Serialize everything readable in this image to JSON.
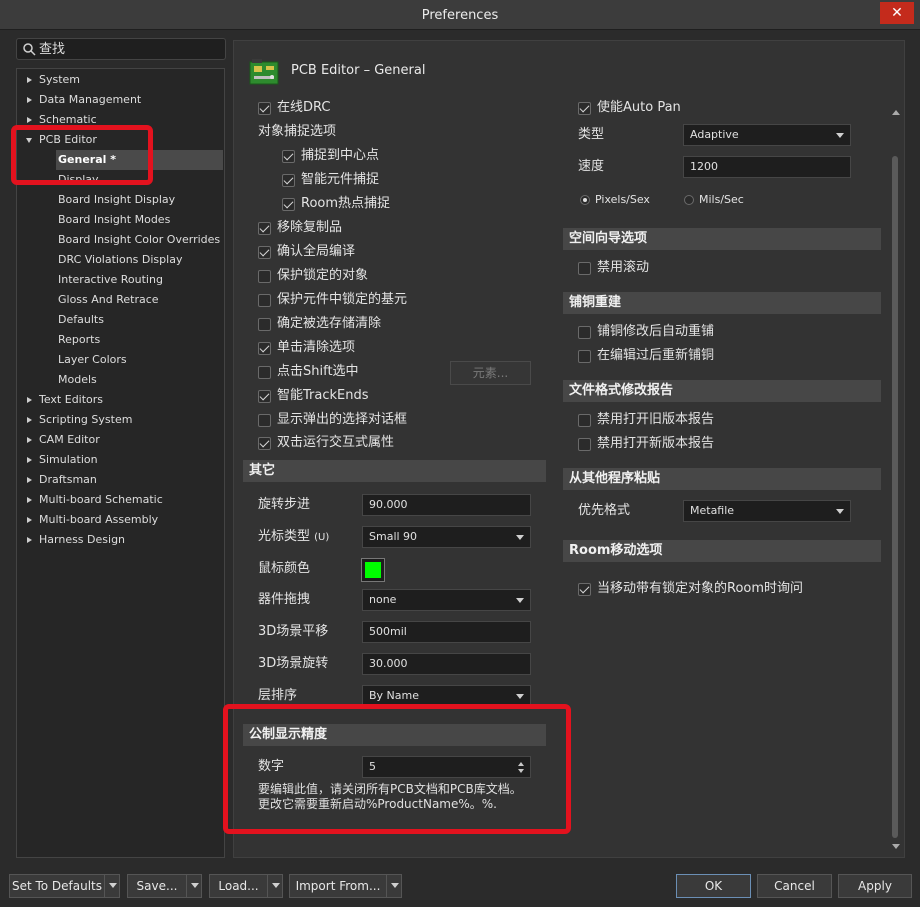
{
  "window": {
    "title": "Preferences",
    "close_glyph": "✕"
  },
  "search": {
    "placeholder": "查找"
  },
  "tree": {
    "items": [
      {
        "label": "System"
      },
      {
        "label": "Data Management"
      },
      {
        "label": "Schematic"
      },
      {
        "label": "PCB Editor"
      },
      {
        "label": "General *"
      },
      {
        "label": "Display"
      },
      {
        "label": "Board Insight Display"
      },
      {
        "label": "Board Insight Modes"
      },
      {
        "label": "Board Insight Color Overrides"
      },
      {
        "label": "DRC Violations Display"
      },
      {
        "label": "Interactive Routing"
      },
      {
        "label": "Gloss And Retrace"
      },
      {
        "label": "Defaults"
      },
      {
        "label": "Reports"
      },
      {
        "label": "Layer Colors"
      },
      {
        "label": "Models"
      },
      {
        "label": "Text Editors"
      },
      {
        "label": "Scripting System"
      },
      {
        "label": "CAM Editor"
      },
      {
        "label": "Simulation"
      },
      {
        "label": "Draftsman"
      },
      {
        "label": "Multi-board Schematic"
      },
      {
        "label": "Multi-board Assembly"
      },
      {
        "label": "Harness Design"
      }
    ]
  },
  "page": {
    "title": "PCB Editor – General"
  },
  "left_col": {
    "online_drc": "在线DRC",
    "snap_group": "对象捕捉选项",
    "snap_center": "捕捉到中心点",
    "smart_snap": "智能元件捕捉",
    "room_snap": "Room热点捕捉",
    "remove_dup": "移除复制品",
    "confirm_global": "确认全局编译",
    "protect_locked": "保护锁定的对象",
    "protect_primitives": "保护元件中锁定的基元",
    "confirm_clear": "确定被选存储清除",
    "click_clear": "单击清除选项",
    "shift_click": "点击Shift选中",
    "primitives_btn": "元素...",
    "smart_trackends": "智能TrackEnds",
    "show_popup": "显示弹出的选择对话框",
    "dblclick_inspect": "双击运行交互式属性"
  },
  "other": {
    "header": "其它",
    "rotation_step": {
      "label": "旋转步进",
      "value": "90.000"
    },
    "cursor_type": {
      "label": "光标类型",
      "hotkey": "(U)",
      "value": "Small 90"
    },
    "cursor_color": {
      "label": "鼠标颜色",
      "color": "#00ff00"
    },
    "comp_drag": {
      "label": "器件拖拽",
      "value": "none"
    },
    "pan_3d": {
      "label": "3D场景平移",
      "value": "500mil"
    },
    "rotate_3d": {
      "label": "3D场景旋转",
      "value": "30.000"
    },
    "layer_order": {
      "label": "层排序",
      "value": "By Name"
    }
  },
  "metric": {
    "header": "公制显示精度",
    "digits": {
      "label": "数字",
      "value": "5"
    },
    "note_line1": "要编辑此值，请关闭所有PCB文档和PCB库文档。",
    "note_line2": "更改它需要重新启动%ProductName%。%."
  },
  "right_col": {
    "autopan": "使能Auto Pan",
    "type": {
      "label": "类型",
      "value": "Adaptive"
    },
    "speed": {
      "label": "速度",
      "value": "1200"
    },
    "pixels": "Pixels/Sex",
    "mils": "Mils/Sec",
    "space_nav_header": "空间向导选项",
    "disable_scroll": "禁用滚动",
    "pour_header": "铺铜重建",
    "repour_modify": "铺铜修改后自动重铺",
    "repour_edit": "在编辑过后重新铺铜",
    "file_mod_header": "文件格式修改报告",
    "disable_old": "禁用打开旧版本报告",
    "disable_new": "禁用打开新版本报告",
    "paste_header": "从其他程序粘贴",
    "pref_format": {
      "label": "优先格式",
      "value": "Metafile"
    },
    "room_move_header": "Room移动选项",
    "room_move_ask": "当移动带有锁定对象的Room时询问"
  },
  "buttons": {
    "set_defaults": "Set To Defaults",
    "save": "Save...",
    "load": "Load...",
    "import": "Import From...",
    "ok": "OK",
    "cancel": "Cancel",
    "apply": "Apply"
  }
}
